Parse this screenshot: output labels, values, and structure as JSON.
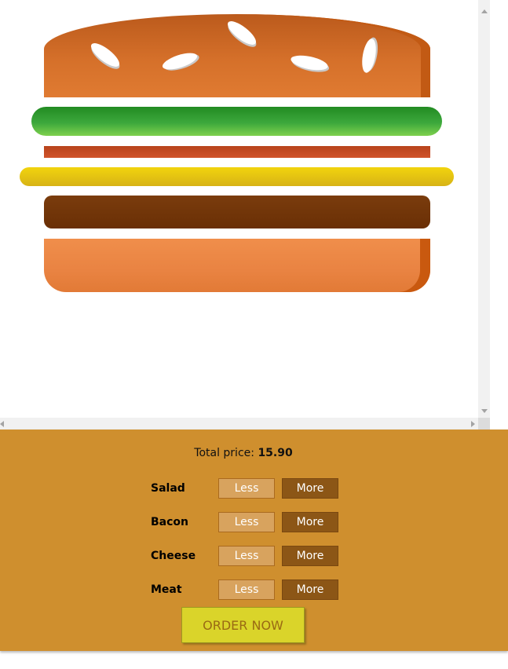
{
  "total": {
    "label": "Total price:",
    "value": "15.90"
  },
  "controls": [
    {
      "label": "Salad",
      "less": "Less",
      "more": "More"
    },
    {
      "label": "Bacon",
      "less": "Less",
      "more": "More"
    },
    {
      "label": "Cheese",
      "less": "Less",
      "more": "More"
    },
    {
      "label": "Meat",
      "less": "Less",
      "more": "More"
    }
  ],
  "order_button": "ORDER NOW",
  "colors": {
    "panel": "#cf8f2e",
    "less_button": "#d8a35e",
    "more_button": "#8c5616",
    "order_button": "#dad42a"
  }
}
